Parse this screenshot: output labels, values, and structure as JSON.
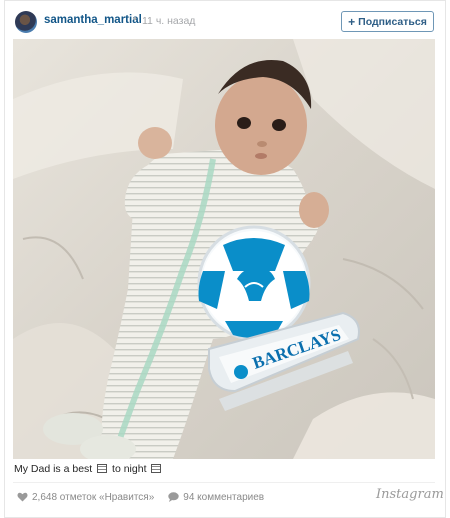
{
  "post": {
    "username": "samantha_martial",
    "separator": "•",
    "time_ago": "11 ч. назад",
    "follow_label": "Подписаться",
    "follow_plus": "+"
  },
  "photo": {
    "trophy_brand": "BARCLAYS"
  },
  "caption": {
    "part1": "My Dad is a best",
    "part2": "to night"
  },
  "stats": {
    "likes": "2,648 отметок «Нравится»",
    "comments": "94 комментариев"
  },
  "brand": "Instagram",
  "colors": {
    "username": "#125688",
    "follow_border": "#6f97b6",
    "barclays_blue": "#0a8ec9"
  },
  "icons": [
    "heart-icon",
    "comment-icon"
  ]
}
